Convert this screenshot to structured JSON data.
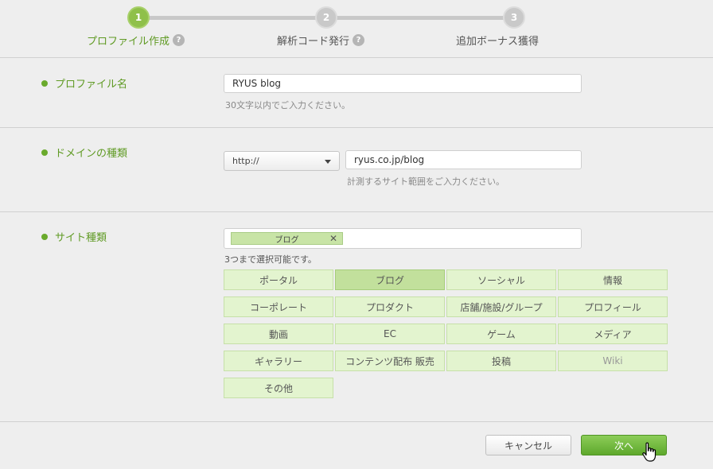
{
  "stepper": {
    "steps": [
      {
        "number": "1",
        "label": "プロファイル作成",
        "help": "?"
      },
      {
        "number": "2",
        "label": "解析コード発行",
        "help": "?"
      },
      {
        "number": "3",
        "label": "追加ボーナス獲得"
      }
    ]
  },
  "profile": {
    "label": "プロファイル名",
    "value": "RYUS blog",
    "hint": "30文字以内でご入力ください。"
  },
  "domain": {
    "label": "ドメインの種類",
    "protocol": "http://",
    "value": "ryus.co.jp/blog",
    "hint": "計測するサイト範囲をご入力ください。"
  },
  "site_type": {
    "label": "サイト種類",
    "selected_tag": "ブログ",
    "remove": "✕",
    "hint": "3つまで選択可能です。",
    "categories": [
      "ポータル",
      "ブログ",
      "ソーシャル",
      "情報",
      "コーポレート",
      "プロダクト",
      "店舗/施設/グループ",
      "プロフィール",
      "動画",
      "EC",
      "ゲーム",
      "メディア",
      "ギャラリー",
      "コンテンツ配布 販売",
      "投稿",
      "Wiki",
      "その他"
    ]
  },
  "actions": {
    "cancel": "キャンセル",
    "next": "次へ"
  },
  "colors": {
    "accent": "#5f9a23",
    "active_step": "#8fc04a",
    "category_bg": "#e3f4cf",
    "category_selected": "#c2e09c"
  }
}
